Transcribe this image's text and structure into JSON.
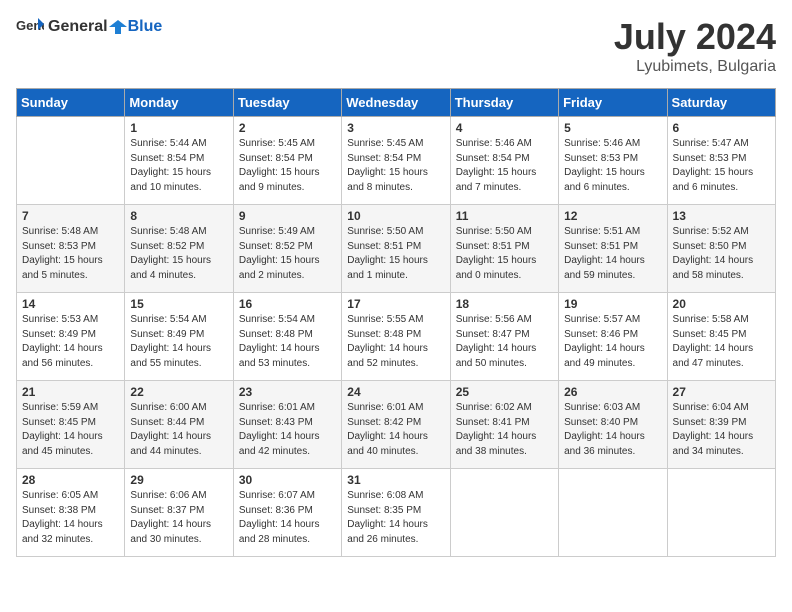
{
  "header": {
    "logo_general": "General",
    "logo_blue": "Blue",
    "month": "July 2024",
    "location": "Lyubimets, Bulgaria"
  },
  "weekdays": [
    "Sunday",
    "Monday",
    "Tuesday",
    "Wednesday",
    "Thursday",
    "Friday",
    "Saturday"
  ],
  "weeks": [
    [
      {
        "day": "",
        "info": ""
      },
      {
        "day": "1",
        "info": "Sunrise: 5:44 AM\nSunset: 8:54 PM\nDaylight: 15 hours\nand 10 minutes."
      },
      {
        "day": "2",
        "info": "Sunrise: 5:45 AM\nSunset: 8:54 PM\nDaylight: 15 hours\nand 9 minutes."
      },
      {
        "day": "3",
        "info": "Sunrise: 5:45 AM\nSunset: 8:54 PM\nDaylight: 15 hours\nand 8 minutes."
      },
      {
        "day": "4",
        "info": "Sunrise: 5:46 AM\nSunset: 8:54 PM\nDaylight: 15 hours\nand 7 minutes."
      },
      {
        "day": "5",
        "info": "Sunrise: 5:46 AM\nSunset: 8:53 PM\nDaylight: 15 hours\nand 6 minutes."
      },
      {
        "day": "6",
        "info": "Sunrise: 5:47 AM\nSunset: 8:53 PM\nDaylight: 15 hours\nand 6 minutes."
      }
    ],
    [
      {
        "day": "7",
        "info": "Sunrise: 5:48 AM\nSunset: 8:53 PM\nDaylight: 15 hours\nand 5 minutes."
      },
      {
        "day": "8",
        "info": "Sunrise: 5:48 AM\nSunset: 8:52 PM\nDaylight: 15 hours\nand 4 minutes."
      },
      {
        "day": "9",
        "info": "Sunrise: 5:49 AM\nSunset: 8:52 PM\nDaylight: 15 hours\nand 2 minutes."
      },
      {
        "day": "10",
        "info": "Sunrise: 5:50 AM\nSunset: 8:51 PM\nDaylight: 15 hours\nand 1 minute."
      },
      {
        "day": "11",
        "info": "Sunrise: 5:50 AM\nSunset: 8:51 PM\nDaylight: 15 hours\nand 0 minutes."
      },
      {
        "day": "12",
        "info": "Sunrise: 5:51 AM\nSunset: 8:51 PM\nDaylight: 14 hours\nand 59 minutes."
      },
      {
        "day": "13",
        "info": "Sunrise: 5:52 AM\nSunset: 8:50 PM\nDaylight: 14 hours\nand 58 minutes."
      }
    ],
    [
      {
        "day": "14",
        "info": "Sunrise: 5:53 AM\nSunset: 8:49 PM\nDaylight: 14 hours\nand 56 minutes."
      },
      {
        "day": "15",
        "info": "Sunrise: 5:54 AM\nSunset: 8:49 PM\nDaylight: 14 hours\nand 55 minutes."
      },
      {
        "day": "16",
        "info": "Sunrise: 5:54 AM\nSunset: 8:48 PM\nDaylight: 14 hours\nand 53 minutes."
      },
      {
        "day": "17",
        "info": "Sunrise: 5:55 AM\nSunset: 8:48 PM\nDaylight: 14 hours\nand 52 minutes."
      },
      {
        "day": "18",
        "info": "Sunrise: 5:56 AM\nSunset: 8:47 PM\nDaylight: 14 hours\nand 50 minutes."
      },
      {
        "day": "19",
        "info": "Sunrise: 5:57 AM\nSunset: 8:46 PM\nDaylight: 14 hours\nand 49 minutes."
      },
      {
        "day": "20",
        "info": "Sunrise: 5:58 AM\nSunset: 8:45 PM\nDaylight: 14 hours\nand 47 minutes."
      }
    ],
    [
      {
        "day": "21",
        "info": "Sunrise: 5:59 AM\nSunset: 8:45 PM\nDaylight: 14 hours\nand 45 minutes."
      },
      {
        "day": "22",
        "info": "Sunrise: 6:00 AM\nSunset: 8:44 PM\nDaylight: 14 hours\nand 44 minutes."
      },
      {
        "day": "23",
        "info": "Sunrise: 6:01 AM\nSunset: 8:43 PM\nDaylight: 14 hours\nand 42 minutes."
      },
      {
        "day": "24",
        "info": "Sunrise: 6:01 AM\nSunset: 8:42 PM\nDaylight: 14 hours\nand 40 minutes."
      },
      {
        "day": "25",
        "info": "Sunrise: 6:02 AM\nSunset: 8:41 PM\nDaylight: 14 hours\nand 38 minutes."
      },
      {
        "day": "26",
        "info": "Sunrise: 6:03 AM\nSunset: 8:40 PM\nDaylight: 14 hours\nand 36 minutes."
      },
      {
        "day": "27",
        "info": "Sunrise: 6:04 AM\nSunset: 8:39 PM\nDaylight: 14 hours\nand 34 minutes."
      }
    ],
    [
      {
        "day": "28",
        "info": "Sunrise: 6:05 AM\nSunset: 8:38 PM\nDaylight: 14 hours\nand 32 minutes."
      },
      {
        "day": "29",
        "info": "Sunrise: 6:06 AM\nSunset: 8:37 PM\nDaylight: 14 hours\nand 30 minutes."
      },
      {
        "day": "30",
        "info": "Sunrise: 6:07 AM\nSunset: 8:36 PM\nDaylight: 14 hours\nand 28 minutes."
      },
      {
        "day": "31",
        "info": "Sunrise: 6:08 AM\nSunset: 8:35 PM\nDaylight: 14 hours\nand 26 minutes."
      },
      {
        "day": "",
        "info": ""
      },
      {
        "day": "",
        "info": ""
      },
      {
        "day": "",
        "info": ""
      }
    ]
  ]
}
